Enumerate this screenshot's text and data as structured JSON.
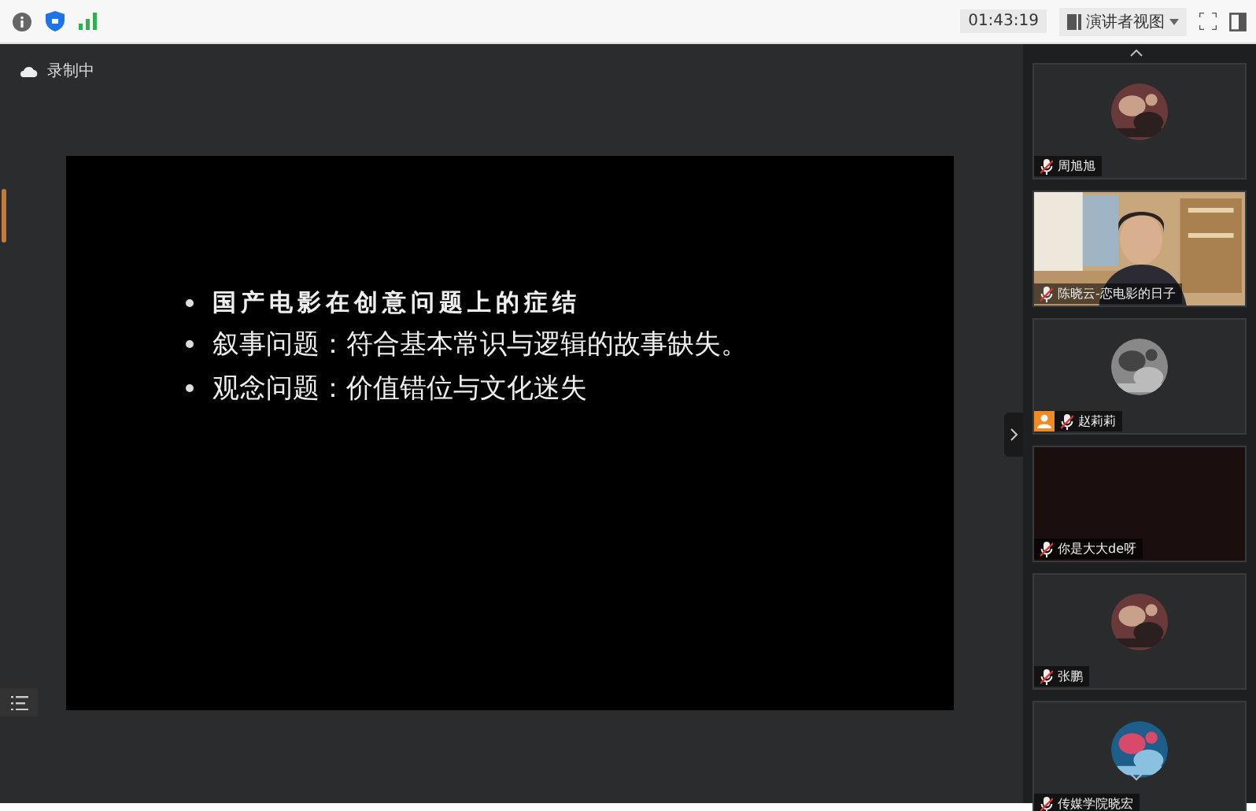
{
  "top_bar": {
    "timer": "01:43:19",
    "view_selector": "演讲者视图"
  },
  "recording": {
    "label": "录制中"
  },
  "slide": {
    "bullets": [
      {
        "text": "国产电影在创意问题上的症结",
        "kind": "heading"
      },
      {
        "text": "叙事问题：符合基本常识与逻辑的故事缺失。",
        "kind": "body"
      },
      {
        "text": "观念问题：价值错位与文化迷失",
        "kind": "body"
      }
    ]
  },
  "participants": [
    {
      "name": "周旭旭",
      "kind": "avatar",
      "host": false
    },
    {
      "name": "陈晓云-恋电影的日子",
      "kind": "video",
      "host": false
    },
    {
      "name": "赵莉莉",
      "kind": "avatar",
      "host": true
    },
    {
      "name": "你是大大de呀",
      "kind": "blank",
      "host": false
    },
    {
      "name": "张鹏",
      "kind": "avatar",
      "host": false
    },
    {
      "name": "传媒学院晓宏",
      "kind": "avatar",
      "host": false
    }
  ]
}
